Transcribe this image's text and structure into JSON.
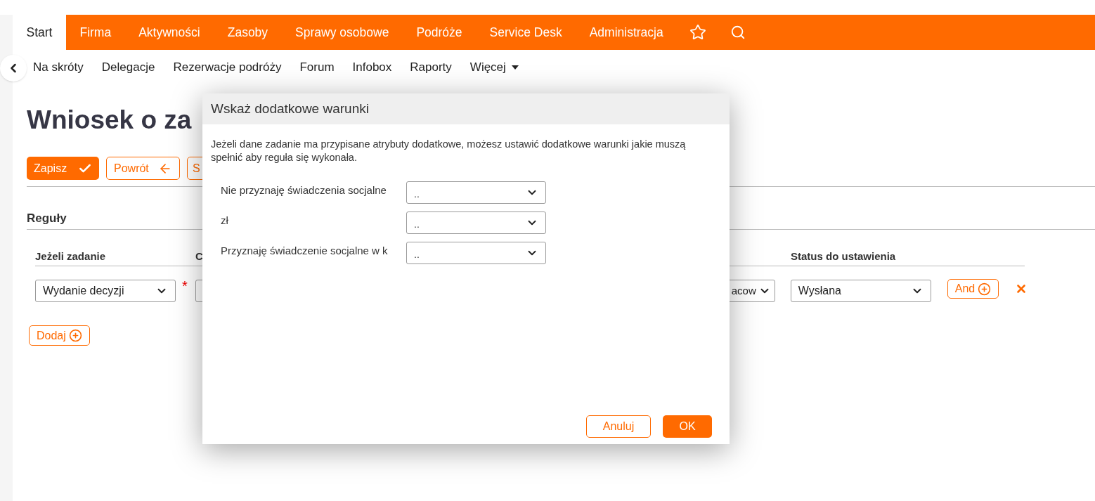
{
  "nav": {
    "tabs": [
      {
        "label": "Start",
        "selected": true
      },
      {
        "label": "Firma",
        "selected": false
      },
      {
        "label": "Aktywności",
        "selected": false
      },
      {
        "label": "Zasoby",
        "selected": false
      },
      {
        "label": "Sprawy osobowe",
        "selected": false
      },
      {
        "label": "Podróże",
        "selected": false
      },
      {
        "label": "Service Desk",
        "selected": false
      },
      {
        "label": "Administracja",
        "selected": false
      }
    ]
  },
  "subnav": {
    "items": [
      "Na skróty",
      "Delegacje",
      "Rezerwacje podróży",
      "Forum",
      "Infobox",
      "Raporty"
    ],
    "more": "Więcej"
  },
  "page": {
    "title": "Wniosek o za",
    "buttons": [
      {
        "label": "Zapisz",
        "kind": "primary"
      },
      {
        "label": "Powrót",
        "kind": "back"
      },
      {
        "label": "S",
        "kind": "plain"
      }
    ],
    "section": "Reguły",
    "table": {
      "columns": [
        "Jeżeli zadanie",
        "C",
        "Status do ustawienia"
      ],
      "rows": [
        {
          "task": "Wydanie decyzji",
          "required_mark": "*",
          "column_2": "acow",
          "status": "Wysłana",
          "and": "And"
        }
      ]
    },
    "add": "Dodaj"
  },
  "dialog": {
    "title": "Wskaż dodatkowe warunki",
    "description": "Jeżeli dane zadanie ma przypisane atrybuty dodatkowe, możesz ustawić dodatkowe warunki jakie muszą spełnić aby reguła się wykonała.",
    "fields": [
      {
        "label": "Nie przyznaję świadczenia socjalne",
        "value": ".."
      },
      {
        "label": "zł",
        "value": ".."
      },
      {
        "label": "Przyznaję świadczenie socjalne w k",
        "value": ".."
      }
    ],
    "buttons": [
      {
        "label": "Anuluj",
        "kind": "secondary"
      },
      {
        "label": "OK",
        "kind": "primary"
      }
    ]
  }
}
